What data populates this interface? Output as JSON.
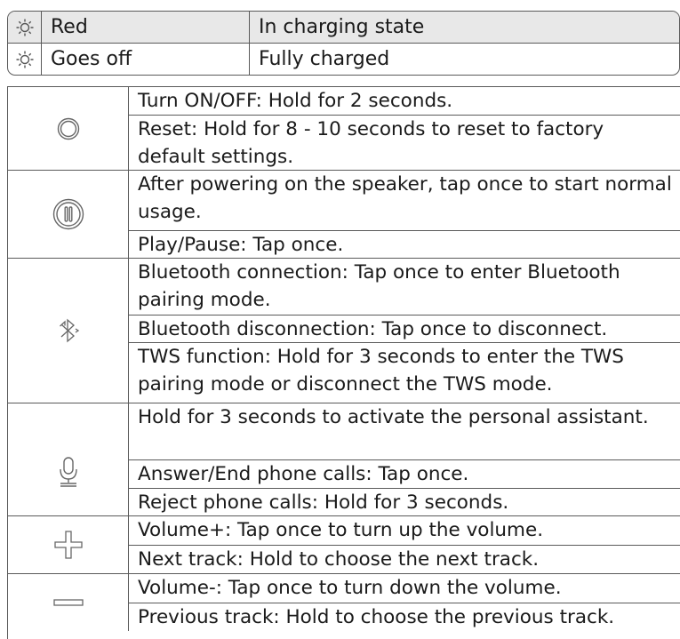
{
  "led_status": [
    {
      "icon": "led-light-icon",
      "color": "Red",
      "state": "In charging state"
    },
    {
      "icon": "led-light-icon",
      "color": "Goes off",
      "state": "Fully charged"
    }
  ],
  "buttons": [
    {
      "icon": "power-ring-icon",
      "lines": [
        "Turn ON/OFF: Hold for 2 seconds.",
        "Reset: Hold for 8 - 10 seconds to reset to factory default settings."
      ]
    },
    {
      "icon": "play-pause-icon",
      "lines": [
        "After powering on the speaker, tap once to start normal usage.",
        "Play/Pause: Tap once."
      ]
    },
    {
      "icon": "bluetooth-icon",
      "lines": [
        "Bluetooth connection: Tap once to enter Bluetooth pairing mode.",
        "Bluetooth disconnection: Tap once to disconnect.",
        "TWS function: Hold for 3 seconds to enter the TWS pairing mode or disconnect the TWS mode."
      ]
    },
    {
      "icon": "microphone-icon",
      "lines": [
        "Hold for 3 seconds to activate the personal assistant.",
        "Answer/End phone calls: Tap once.",
        "Reject phone calls: Hold for 3 seconds."
      ]
    },
    {
      "icon": "plus-icon",
      "lines": [
        "Volume+: Tap once to turn up the volume.",
        "Next track: Hold to choose the next track."
      ]
    },
    {
      "icon": "minus-icon",
      "lines": [
        "Volume-: Tap once to turn down the volume.",
        "Previous track: Hold to choose the previous track."
      ]
    }
  ]
}
